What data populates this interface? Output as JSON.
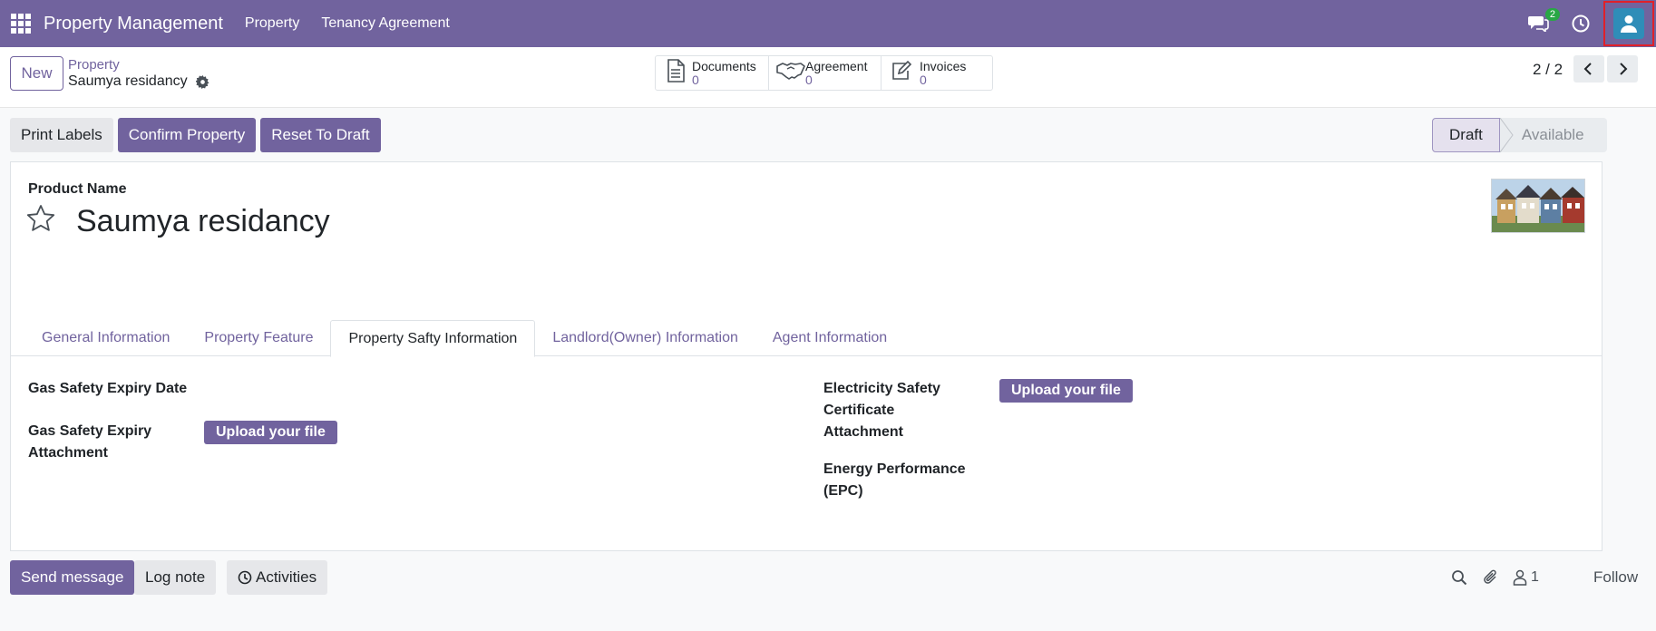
{
  "navbar": {
    "app_name": "Property Management",
    "menu": [
      "Property",
      "Tenancy Agreement"
    ],
    "chat_badge": "2"
  },
  "control_panel": {
    "new_label": "New",
    "breadcrumb_parent": "Property",
    "breadcrumb_current": "Saumya residancy",
    "smart_buttons": [
      {
        "label": "Documents",
        "value": "0",
        "icon": "document-icon"
      },
      {
        "label": "Agreement",
        "value": "0",
        "icon": "handshake-icon"
      },
      {
        "label": "Invoices",
        "value": "0",
        "icon": "edit-icon"
      }
    ],
    "pager": "2 / 2"
  },
  "actions": {
    "print_labels": "Print Labels",
    "confirm_property": "Confirm Property",
    "reset_to_draft": "Reset To Draft"
  },
  "status": {
    "stages": [
      "Draft",
      "Available"
    ],
    "active": "Draft"
  },
  "form": {
    "product_name_label": "Product Name",
    "product_name": "Saumya residancy",
    "tabs": [
      "General Information",
      "Property Feature",
      "Property Safty Information",
      "Landlord(Owner) Information",
      "Agent Information"
    ],
    "active_tab": "Property Safty Information",
    "fields": {
      "gas_expiry_date": "Gas Safety Expiry Date",
      "gas_expiry_attachment_l1": "Gas Safety Expiry",
      "gas_expiry_attachment_l2": "Attachment",
      "electricity_l1": "Electricity Safety",
      "electricity_l2": "Certificate",
      "electricity_l3": "Attachment",
      "epc_l1": "Energy Performance",
      "epc_l2": "(EPC)"
    },
    "upload_label": "Upload your file"
  },
  "chatter": {
    "send_message": "Send message",
    "log_note": "Log note",
    "activities": "Activities",
    "followers": "1",
    "follow": "Follow"
  },
  "colors": {
    "brand": "#71639e",
    "avatar": "#2f8db8",
    "badge": "#28a745",
    "highlight": "#e0202a"
  }
}
